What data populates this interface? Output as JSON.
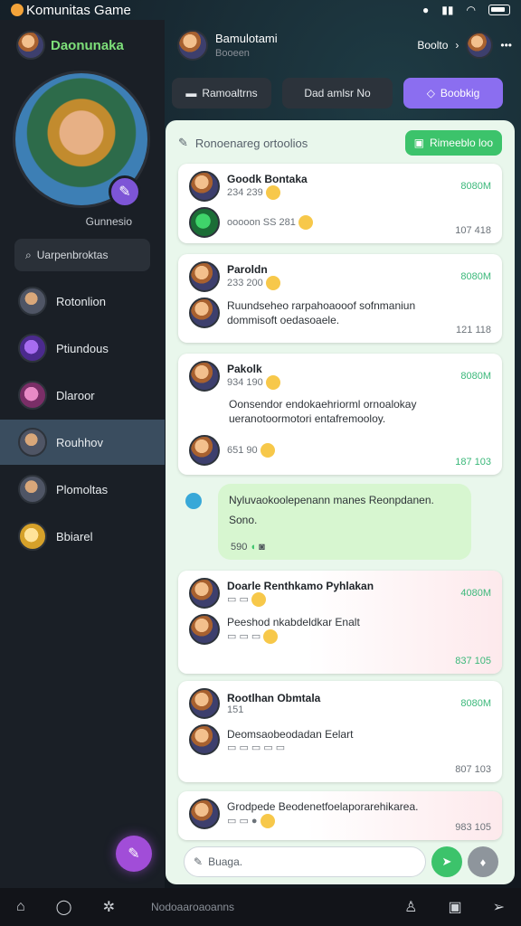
{
  "status": {
    "app_title": "Komunitas Game"
  },
  "sidebar": {
    "brand": "Daonunaka",
    "hero_caption": "Gunnesio",
    "search_placeholder": "Uarpenbroktas",
    "items": [
      {
        "label": "Rotonlion",
        "avatar": "grey"
      },
      {
        "label": "Ptiundous",
        "avatar": "purple"
      },
      {
        "label": "Dlaroor",
        "avatar": "pink"
      },
      {
        "label": "Rouhhov",
        "avatar": "grey"
      },
      {
        "label": "Plomoltas",
        "avatar": "grey"
      },
      {
        "label": "Bbiarel",
        "avatar": "yellow"
      }
    ]
  },
  "header": {
    "title": "Bamulotami",
    "subtitle": "Booeen",
    "right_label": "Boolto"
  },
  "tabs": [
    {
      "label": "Ramoaltrns"
    },
    {
      "label": "Dad amlsr No"
    },
    {
      "label": "Boobkig"
    }
  ],
  "main": {
    "top_placeholder": "Ronoenareg ortoolios",
    "top_pill": "Rimeeblo loo",
    "cards": [
      {
        "name": "Goodk Bontaka",
        "meta1": "234  239",
        "meta2": "ooooon  SS 281",
        "time": "8080M",
        "count": "107 418",
        "avatar": "grey",
        "avatar2": "green"
      },
      {
        "name": "Paroldn",
        "meta1": "233  200",
        "text": "Ruundseheo rarpahoaooof sofnmaniun dommisoft oedasoaele.",
        "time": "8080M",
        "count": "121 118",
        "avatar": "grey"
      },
      {
        "name": "Pakolk",
        "meta1": "934  190",
        "text": "Oonsendor endokaehriorml ornoalokay ueranotoormotori entafremooloy.",
        "meta2": "651  90",
        "time": "8080M",
        "count": "187 103",
        "avatar": "grey"
      },
      {
        "name": "Doarle Renthkamo Pyhlakan",
        "text": "Peeshod nkabdeldkar Enalt",
        "time": "4080M",
        "count": "837 105",
        "avatar": "grey"
      },
      {
        "name": "Rootlhan Obmtala",
        "meta1": "151",
        "text": "Deomsaobeodadan  Eelart",
        "time": "8080M",
        "count": "807 103",
        "avatar": "grey"
      },
      {
        "name": "Grodpede Beodenetfoelaporarehikarea.",
        "time": "",
        "count": "983 105",
        "avatar": "grey"
      }
    ],
    "bubble": {
      "text": "Nyluvaokoolepenann manes Reonpdanen.",
      "line2": "Sono.",
      "footer": "590"
    },
    "composer_placeholder": "Buaga."
  },
  "bottom_nav": {
    "center_label": "Nodoaaroaoanns"
  },
  "colors": {
    "accent_green": "#3cc36b",
    "accent_purple": "#8b6ef0"
  }
}
